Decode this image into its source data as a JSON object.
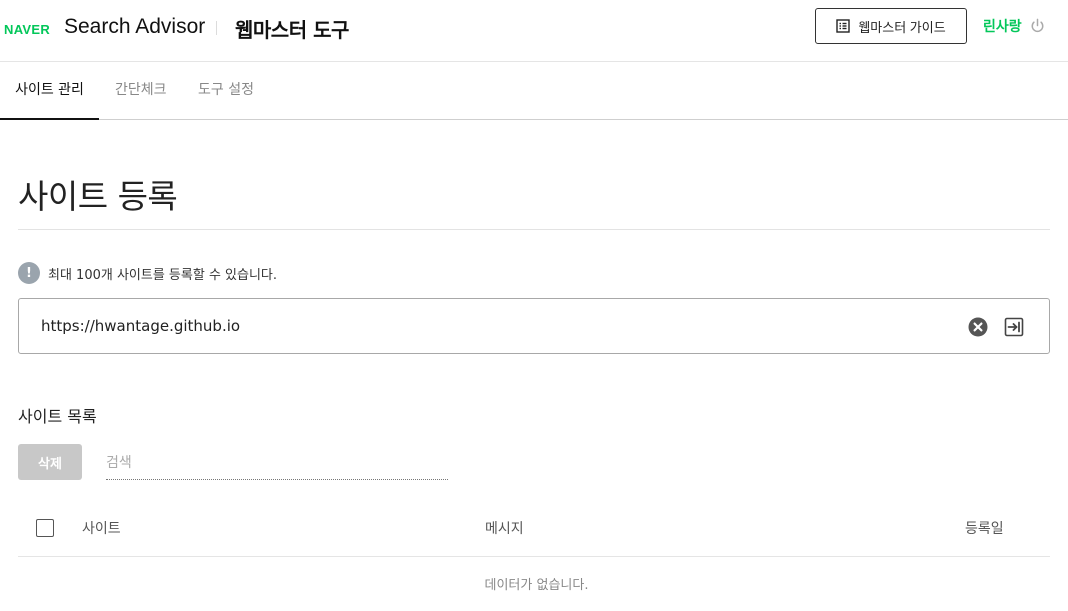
{
  "header": {
    "logo": "NAVER",
    "product": "Search Advisor",
    "tool_title": "웹마스터 도구",
    "guide_button": "웹마스터 가이드",
    "user_name": "린사랑",
    "icons": {
      "guide": "document-list-icon",
      "power": "power-icon"
    }
  },
  "tabs": [
    {
      "label": "사이트 관리",
      "active": true
    },
    {
      "label": "간단체크",
      "active": false
    },
    {
      "label": "도구 설정",
      "active": false
    }
  ],
  "page": {
    "title": "사이트 등록",
    "notice": "최대 100개 사이트를 등록할 수 있습니다.",
    "notice_icon": "!",
    "url_value": "https://hwantage.github.io",
    "icons": {
      "notice": "info-icon",
      "clear": "clear-icon",
      "submit": "submit-arrow-icon"
    }
  },
  "site_list": {
    "title": "사이트 목록",
    "delete_button": "삭제",
    "search_placeholder": "검색",
    "columns": [
      "사이트",
      "메시지",
      "등록일"
    ],
    "empty_message": "데이터가 없습니다."
  },
  "colors": {
    "brand": "#03c75a",
    "text": "#222222",
    "muted": "#888888",
    "disabled_button": "#c8c8c8",
    "notice_icon": "#9aa4ad"
  }
}
